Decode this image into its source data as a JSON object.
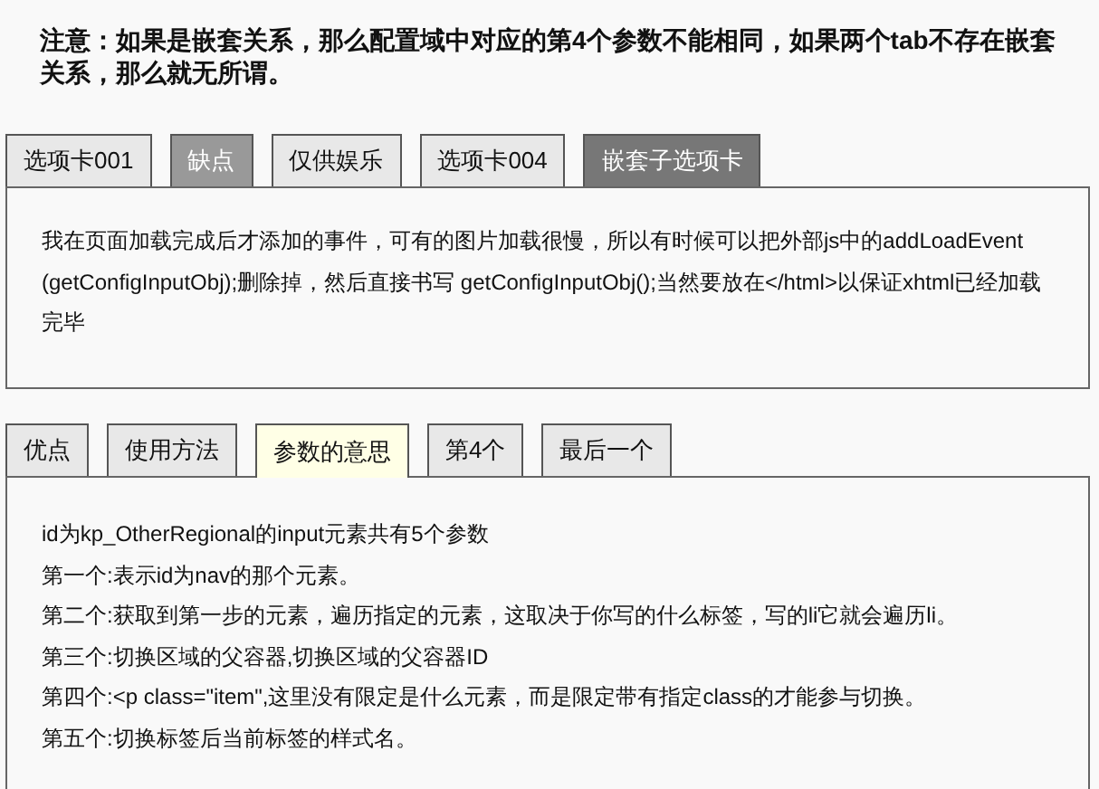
{
  "notice": "注意：如果是嵌套关系，那么配置域中对应的第4个参数不能相同，如果两个tab不存在嵌套关系，那么就无所谓。",
  "tabs_top": [
    {
      "label": "选项卡001",
      "kind": "plain",
      "selected": false
    },
    {
      "label": "缺点",
      "kind": "gray",
      "selected": false
    },
    {
      "label": "仅供娱乐",
      "kind": "plain",
      "selected": false
    },
    {
      "label": "选项卡004",
      "kind": "plain",
      "selected": false
    },
    {
      "label": "嵌套子选项卡",
      "kind": "dark",
      "selected": false
    }
  ],
  "panel_top": {
    "paragraphs": [
      "我在页面加载完成后才添加的事件，可有的图片加载很慢，所以有时候可以把外部js中的addLoadEvent (getConfigInputObj);删除掉，然后直接书写 getConfigInputObj();当然要放在</html>以保证xhtml已经加载完毕"
    ]
  },
  "tabs_bottom": [
    {
      "label": "优点",
      "selected": false
    },
    {
      "label": "使用方法",
      "selected": false
    },
    {
      "label": "参数的意思",
      "selected": true
    },
    {
      "label": "第4个",
      "selected": false
    },
    {
      "label": "最后一个",
      "selected": false
    }
  ],
  "panel_bottom": {
    "paragraphs": [
      "id为kp_OtherRegional的input元素共有5个参数",
      "第一个:表示id为nav的那个元素。",
      "第二个:获取到第一步的元素，遍历指定的元素，这取决于你写的什么标签，写的li它就会遍历li。",
      "第三个:切换区域的父容器,切换区域的父容器ID",
      "第四个:<p class=\"item\",这里没有限定是什么元素，而是限定带有指定class的才能参与切换。",
      "第五个:切换标签后当前标签的样式名。"
    ]
  }
}
